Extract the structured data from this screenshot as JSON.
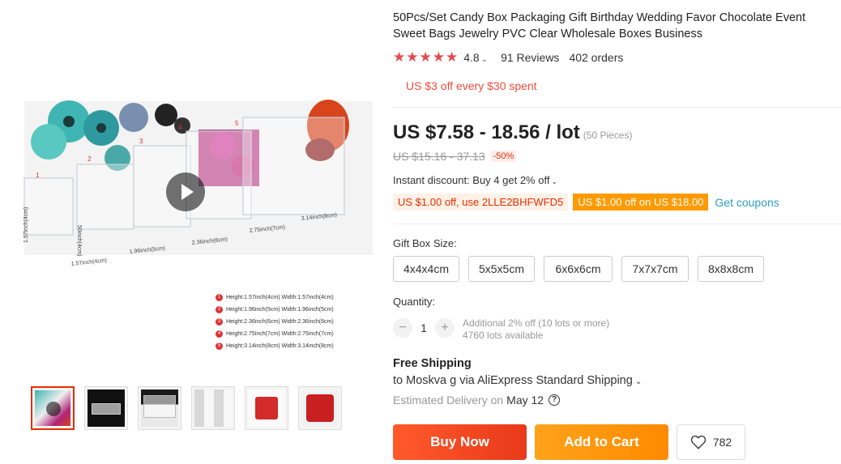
{
  "product": {
    "title": "50Pcs/Set Candy Box Packaging Gift Birthday Wedding Favor Chocolate Event Sweet Bags Jewelry PVC Clear Wholesale Boxes Business",
    "stars": "★★★★★",
    "rating": "4.8",
    "reviews": "91 Reviews",
    "orders": "402 orders",
    "store_promo": "US $3 off every $30 spent"
  },
  "image": {
    "dimension_labels": [
      "1.57inch(4cm)",
      "1.96inch(5cm)",
      "2.36inch(6cm)",
      "2.75inch(7cm)",
      "3.14inch(8cm)"
    ],
    "side_labels": [
      "1.57inch(4cm)",
      "50inch(4cm)"
    ],
    "box_numbers": [
      "1",
      "2",
      "3",
      "4",
      "5"
    ],
    "legend": [
      {
        "num": "1",
        "text": "Height:1.57inch(4cm) Width:1.57inch(4cm)"
      },
      {
        "num": "2",
        "text": "Height:1.96inch(5cm) Width:1.96inch(5cm)"
      },
      {
        "num": "3",
        "text": "Height:2.36inch(6cm) Width:2.36inch(6cm)"
      },
      {
        "num": "4",
        "text": "Height:2.75inch(7cm) Width:2.75inch(7cm)"
      },
      {
        "num": "5",
        "text": "Height:3.14inch(8cm) Width:3.14inch(8cm)"
      }
    ]
  },
  "thumbnails": [
    "thumb-1",
    "thumb-2",
    "thumb-3",
    "thumb-4",
    "thumb-5",
    "thumb-6"
  ],
  "pricing": {
    "price": "US $7.58 - 18.56 / lot",
    "pieces": "(50 Pieces)",
    "old_price": "US $15.16 - 37.13",
    "discount": "-50%",
    "instant_discount": "Instant discount: Buy 4 get 2% off",
    "coupon_code": "US $1.00 off, use 2LLE2BHFWFD5",
    "coupon_threshold": "US $1.00 off on US $18.00",
    "get_coupons": "Get coupons"
  },
  "options": {
    "size_label": "Gift Box Size:",
    "sizes": [
      "4x4x4cm",
      "5x5x5cm",
      "6x6x6cm",
      "7x7x7cm",
      "8x8x8cm"
    ]
  },
  "quantity": {
    "label": "Quantity:",
    "minus": "−",
    "value": "1",
    "plus": "+",
    "additional": "Additional 2% off (10 lots or more)",
    "available": "4760 lots available"
  },
  "shipping": {
    "title": "Free Shipping",
    "destination": "to Moskva g via AliExpress Standard Shipping",
    "delivery_label": "Estimated Delivery on",
    "delivery_date": "May 12",
    "help": "?"
  },
  "actions": {
    "buy_now": "Buy Now",
    "add_to_cart": "Add to Cart",
    "wishlist_count": "782"
  },
  "colors": {
    "accent": "#e62e04",
    "star": "#e8474f",
    "buy_now": "#ff5a2b",
    "add_cart": "#ff9a00",
    "link": "#2e9cc3"
  }
}
